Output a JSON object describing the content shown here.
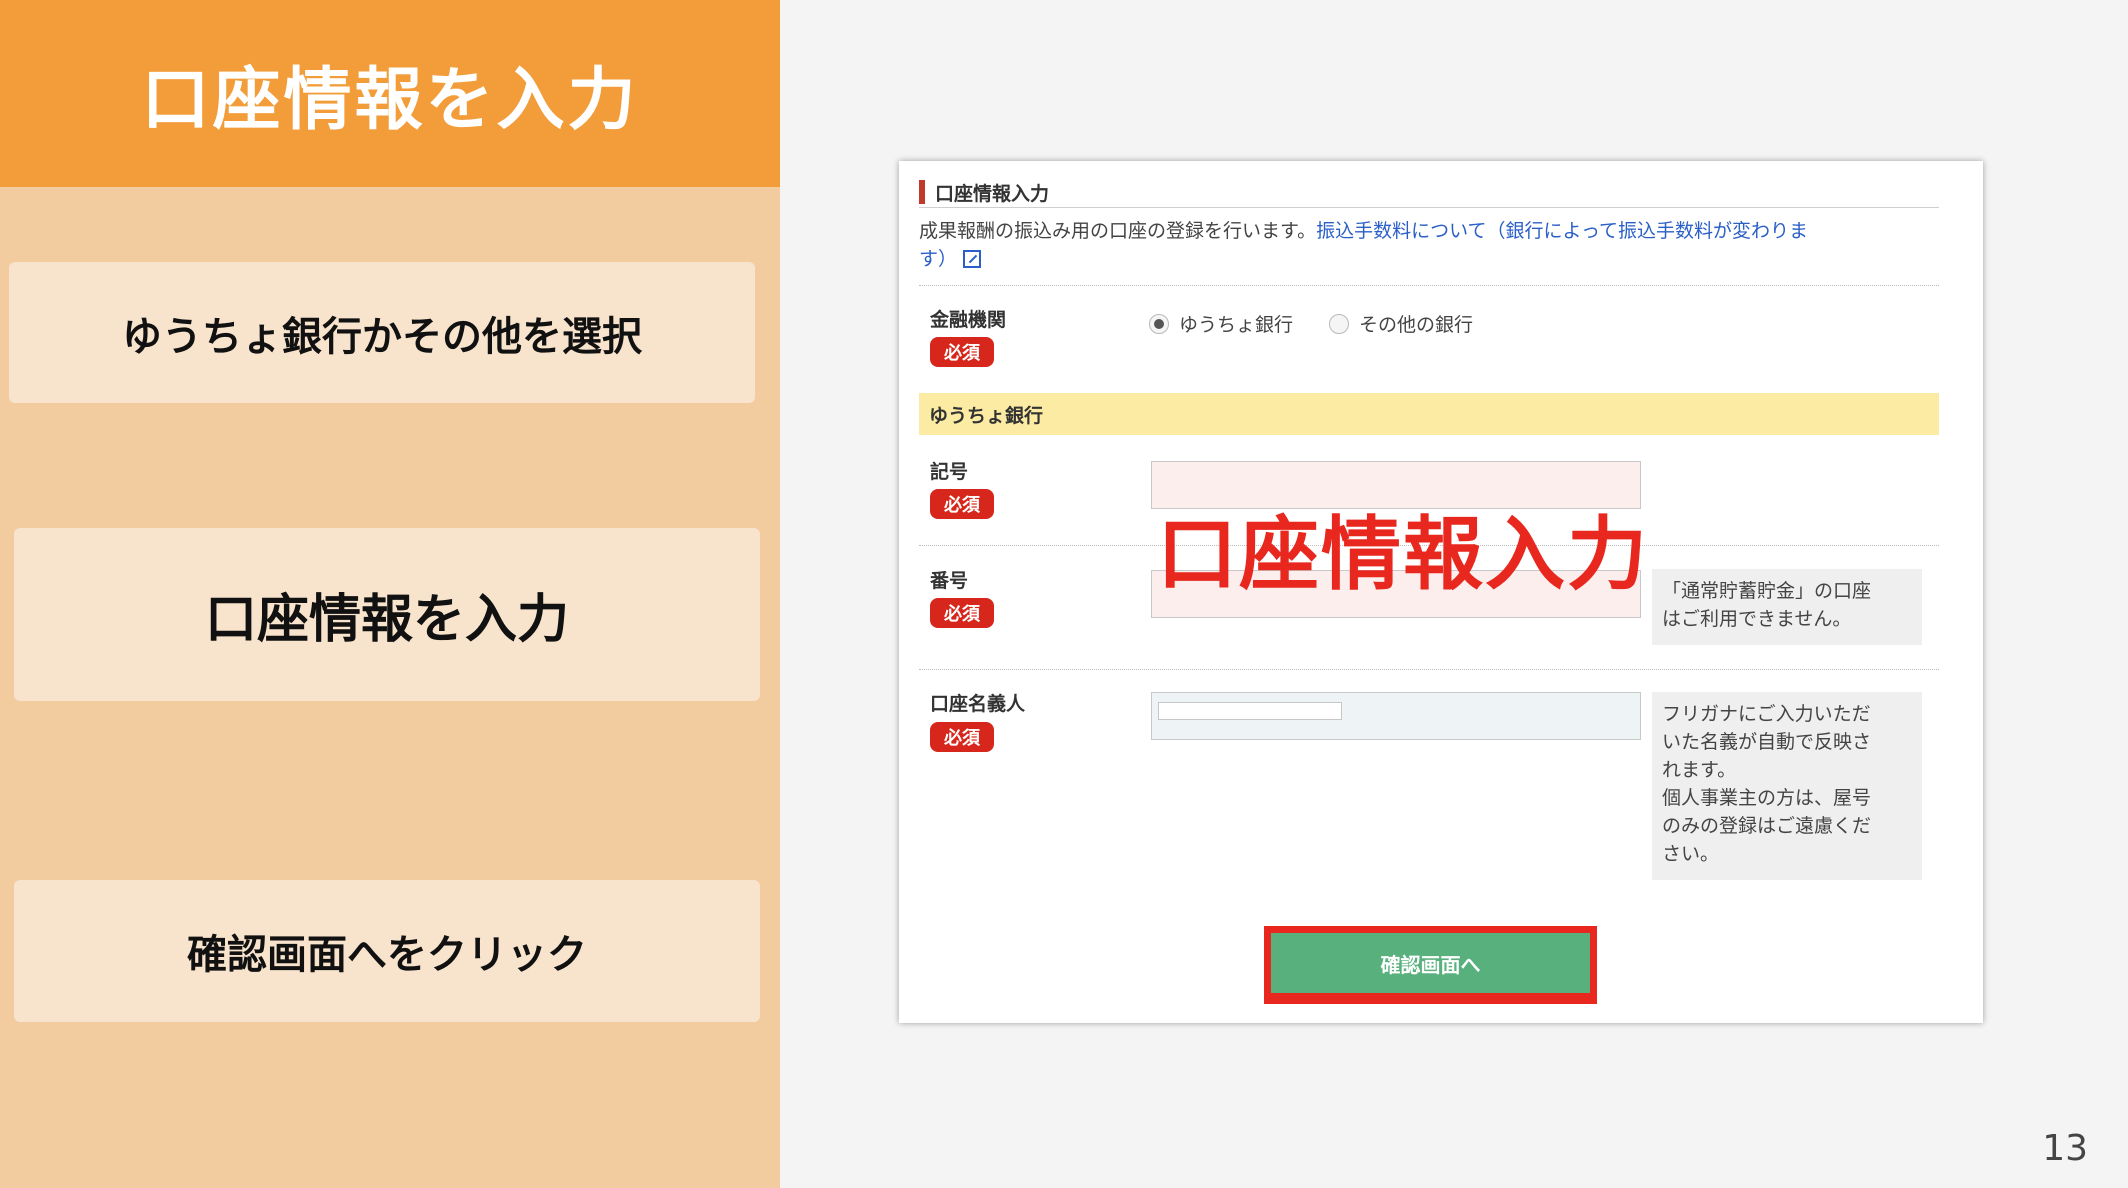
{
  "left_panel": {
    "header": "口座情報を入力",
    "steps": [
      {
        "label": "ゆうちょ銀行かその他を選択"
      },
      {
        "label": "口座情報を入力"
      },
      {
        "label": "確認画面へをクリック"
      }
    ]
  },
  "form": {
    "section_title": "口座情報入力",
    "description": "成果報酬の振込み用の口座の登録を行います。",
    "fee_link_line1": "振込手数料について（銀行によって振込手数料が変わりま",
    "fee_link_line2": "す）",
    "bank_label": "金融機関",
    "required_badge": "必須",
    "bank_options": [
      {
        "label": "ゆうちょ銀行",
        "selected": true
      },
      {
        "label": "その他の銀行",
        "selected": false
      }
    ],
    "section_band": "ゆうちょ銀行",
    "symbol_label": "記号",
    "symbol_value": "",
    "number_label": "番号",
    "number_value": "",
    "overlay_title": "口座情報入力",
    "number_note_lines": [
      "「通常貯蓄貯金」の口座",
      "はご利用できません。"
    ],
    "holder_label": "口座名義人",
    "holder_value": "",
    "holder_note_lines": [
      "フリガナにご入力いただ",
      "いた名義が自動で反映さ",
      "れます。",
      "個人事業主の方は、屋号",
      "のみの登録はご遠慮くだ",
      "さい。"
    ],
    "confirm_button": "確認画面へ"
  },
  "page_number": "13",
  "colors": {
    "header_orange": "#f29d3a",
    "panel_peach": "#f2cb9f",
    "required_red": "#d7261b",
    "link_blue": "#2a5fc7",
    "band_yellow": "#fbeba3",
    "button_green": "#58b07d",
    "highlight_red": "#e8281e"
  }
}
